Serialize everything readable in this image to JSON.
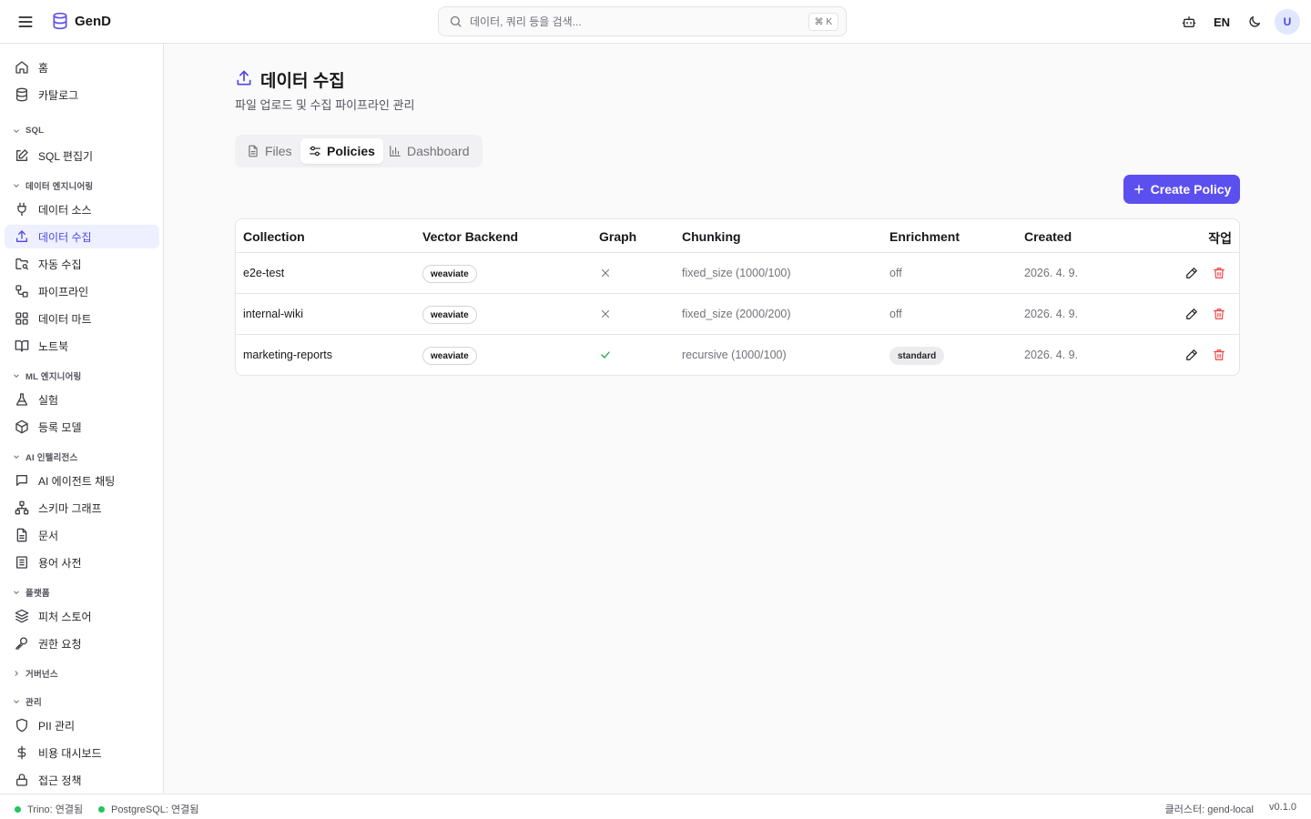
{
  "header": {
    "app_name": "GenD",
    "search_placeholder": "데이터, 쿼리 등을 검색...",
    "search_shortcut": "⌘ K",
    "lang": "EN",
    "avatar_initial": "U"
  },
  "sidebar": {
    "top_items": [
      {
        "label": "홈",
        "icon": "home-icon"
      },
      {
        "label": "카탈로그",
        "icon": "database-icon"
      }
    ],
    "sections": {
      "sql": "SQL",
      "data_eng": "데이터 엔지니어링",
      "ml_eng": "ML 엔지니어링",
      "ai": "AI 인텔리전스",
      "platform": "플랫폼",
      "governance": "거버넌스",
      "admin": "관리"
    },
    "items": {
      "sql_editor": "SQL 편집기",
      "data_source": "데이터 소스",
      "data_ingest": "데이터 수집",
      "auto_ingest": "자동 수집",
      "pipeline": "파이프라인",
      "data_mart": "데이터 마트",
      "notebook": "노트북",
      "experiment": "실험",
      "registered_model": "등록 모델",
      "ai_chat": "AI 에이전트 채팅",
      "schema_graph": "스키마 그래프",
      "documents": "문서",
      "glossary": "용어 사전",
      "feature_store": "피처 스토어",
      "access_request": "권한 요청",
      "pii": "PII 관리",
      "cost_dashboard": "비용 대시보드",
      "access_policy": "접근 정책"
    }
  },
  "main": {
    "title": "데이터 수집",
    "subtitle": "파일 업로드 및 수집 파이프라인 관리",
    "tabs": [
      {
        "label": "Files",
        "active": false
      },
      {
        "label": "Policies",
        "active": true
      },
      {
        "label": "Dashboard",
        "active": false
      }
    ],
    "create_button": "Create Policy",
    "table": {
      "columns": [
        "Collection",
        "Vector Backend",
        "Graph",
        "Chunking",
        "Enrichment",
        "Created",
        "작업"
      ],
      "rows": [
        {
          "collection": "e2e-test",
          "vector_backend": "weaviate",
          "graph": false,
          "chunking": "fixed_size (1000/100)",
          "enrichment": "off",
          "created": "2026. 4. 9."
        },
        {
          "collection": "internal-wiki",
          "vector_backend": "weaviate",
          "graph": false,
          "chunking": "fixed_size (2000/200)",
          "enrichment": "off",
          "created": "2026. 4. 9."
        },
        {
          "collection": "marketing-reports",
          "vector_backend": "weaviate",
          "graph": true,
          "chunking": "recursive (1000/100)",
          "enrichment": "standard",
          "created": "2026. 4. 9."
        }
      ]
    }
  },
  "statusbar": {
    "trino": "Trino: 연결됨",
    "postgres": "PostgreSQL: 연결됨",
    "cluster": "클러스터: gend-local",
    "version": "v0.1.0"
  },
  "colors": {
    "accent": "#5b4ff0",
    "status_ok": "#22c55e",
    "danger": "#ef4444"
  }
}
